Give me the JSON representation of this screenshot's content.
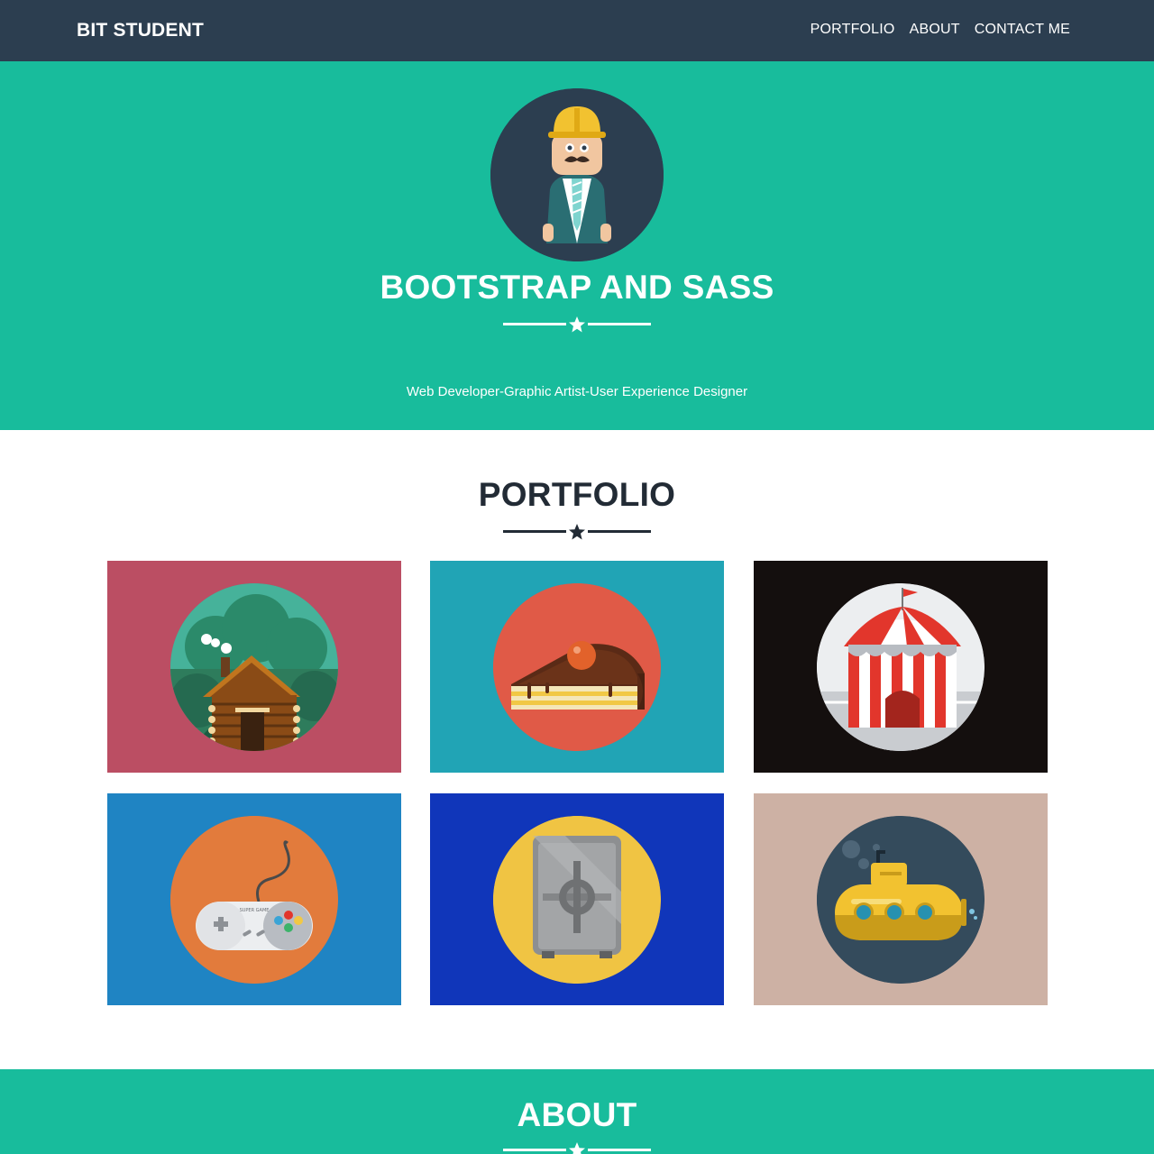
{
  "nav": {
    "brand": "BIT STUDENT",
    "links": [
      "PORTFOLIO",
      "ABOUT",
      "CONTACT ME"
    ]
  },
  "hero": {
    "title": "BOOTSTRAP AND SASS",
    "subtitle": "Web Developer-Graphic Artist-User Experience Designer",
    "background": "#18bc9c"
  },
  "portfolio": {
    "title": "PORTFOLIO",
    "items": [
      {
        "icon": "cabin-icon",
        "background": "#bb4e63"
      },
      {
        "icon": "cake-icon",
        "background": "#21a4b5"
      },
      {
        "icon": "circus-tent-icon",
        "background": "#140f0e"
      },
      {
        "icon": "game-controller-icon",
        "background": "#1f84c3"
      },
      {
        "icon": "safe-icon",
        "background": "#1036ba"
      },
      {
        "icon": "submarine-icon",
        "background": "#cdb1a4"
      }
    ]
  },
  "controller_label": "SUPER GAME",
  "about": {
    "title": "ABOUT"
  },
  "colors": {
    "navbar": "#2c3e50",
    "accent": "#18bc9c",
    "dark_text": "#222b35"
  }
}
